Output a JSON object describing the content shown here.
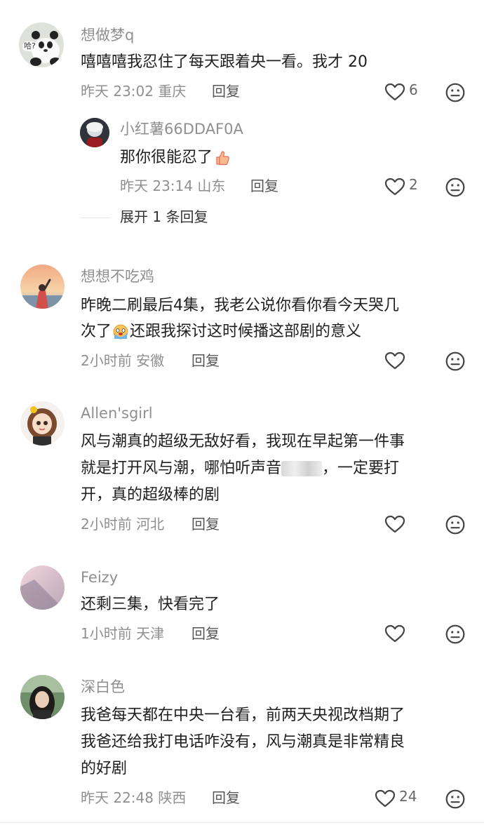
{
  "comments": [
    {
      "username": "想做梦q",
      "text": [
        "嘻嘻嘻我忍住了每天跟着央一看。我才 20"
      ],
      "time": "昨天 23:02",
      "location": "重庆",
      "reply_label": "回复",
      "likes": "6",
      "avatar_badge": "哈?",
      "replies": [
        {
          "username": "小红薯66DDAF0A",
          "text": "那你很能忍了",
          "emoji": "thumbs-up-emoji",
          "time": "昨天 23:14",
          "location": "山东",
          "reply_label": "回复",
          "likes": "2"
        }
      ],
      "expand_label": "展开 1 条回复"
    },
    {
      "username": "想想不吃鸡",
      "text": [
        "昨晚二刷最后4集，我老公说你看你看今天哭几",
        "次了",
        "还跟我探讨这时候播这部剧的意义"
      ],
      "emoji": "crying-emoji",
      "time": "2小时前",
      "location": "安徽",
      "reply_label": "回复",
      "likes": ""
    },
    {
      "username": "Allen'sgirl",
      "text": [
        "风与潮真的超级无敌好看，我现在早起第一件事",
        "就是打开风与潮，哪怕听声音",
        "，一定要打",
        "开，真的超级棒的剧"
      ],
      "time": "2小时前",
      "location": "河北",
      "reply_label": "回复",
      "likes": ""
    },
    {
      "username": "Feizy",
      "text": [
        "还剩三集，快看完了"
      ],
      "time": "1小时前",
      "location": "天津",
      "reply_label": "回复",
      "likes": ""
    },
    {
      "username": "深白色",
      "text": [
        "我爸每天都在中央一台看，前两天央视改档期了",
        "我爸还给我打电话咋没有，风与潮真是非常精良",
        "的好剧"
      ],
      "time": "昨天 22:48",
      "location": "陕西",
      "reply_label": "回复",
      "likes": "24"
    }
  ],
  "colors": {
    "meta": "#8f8f8f",
    "text": "#1f1f1f",
    "icon": "#444444"
  }
}
